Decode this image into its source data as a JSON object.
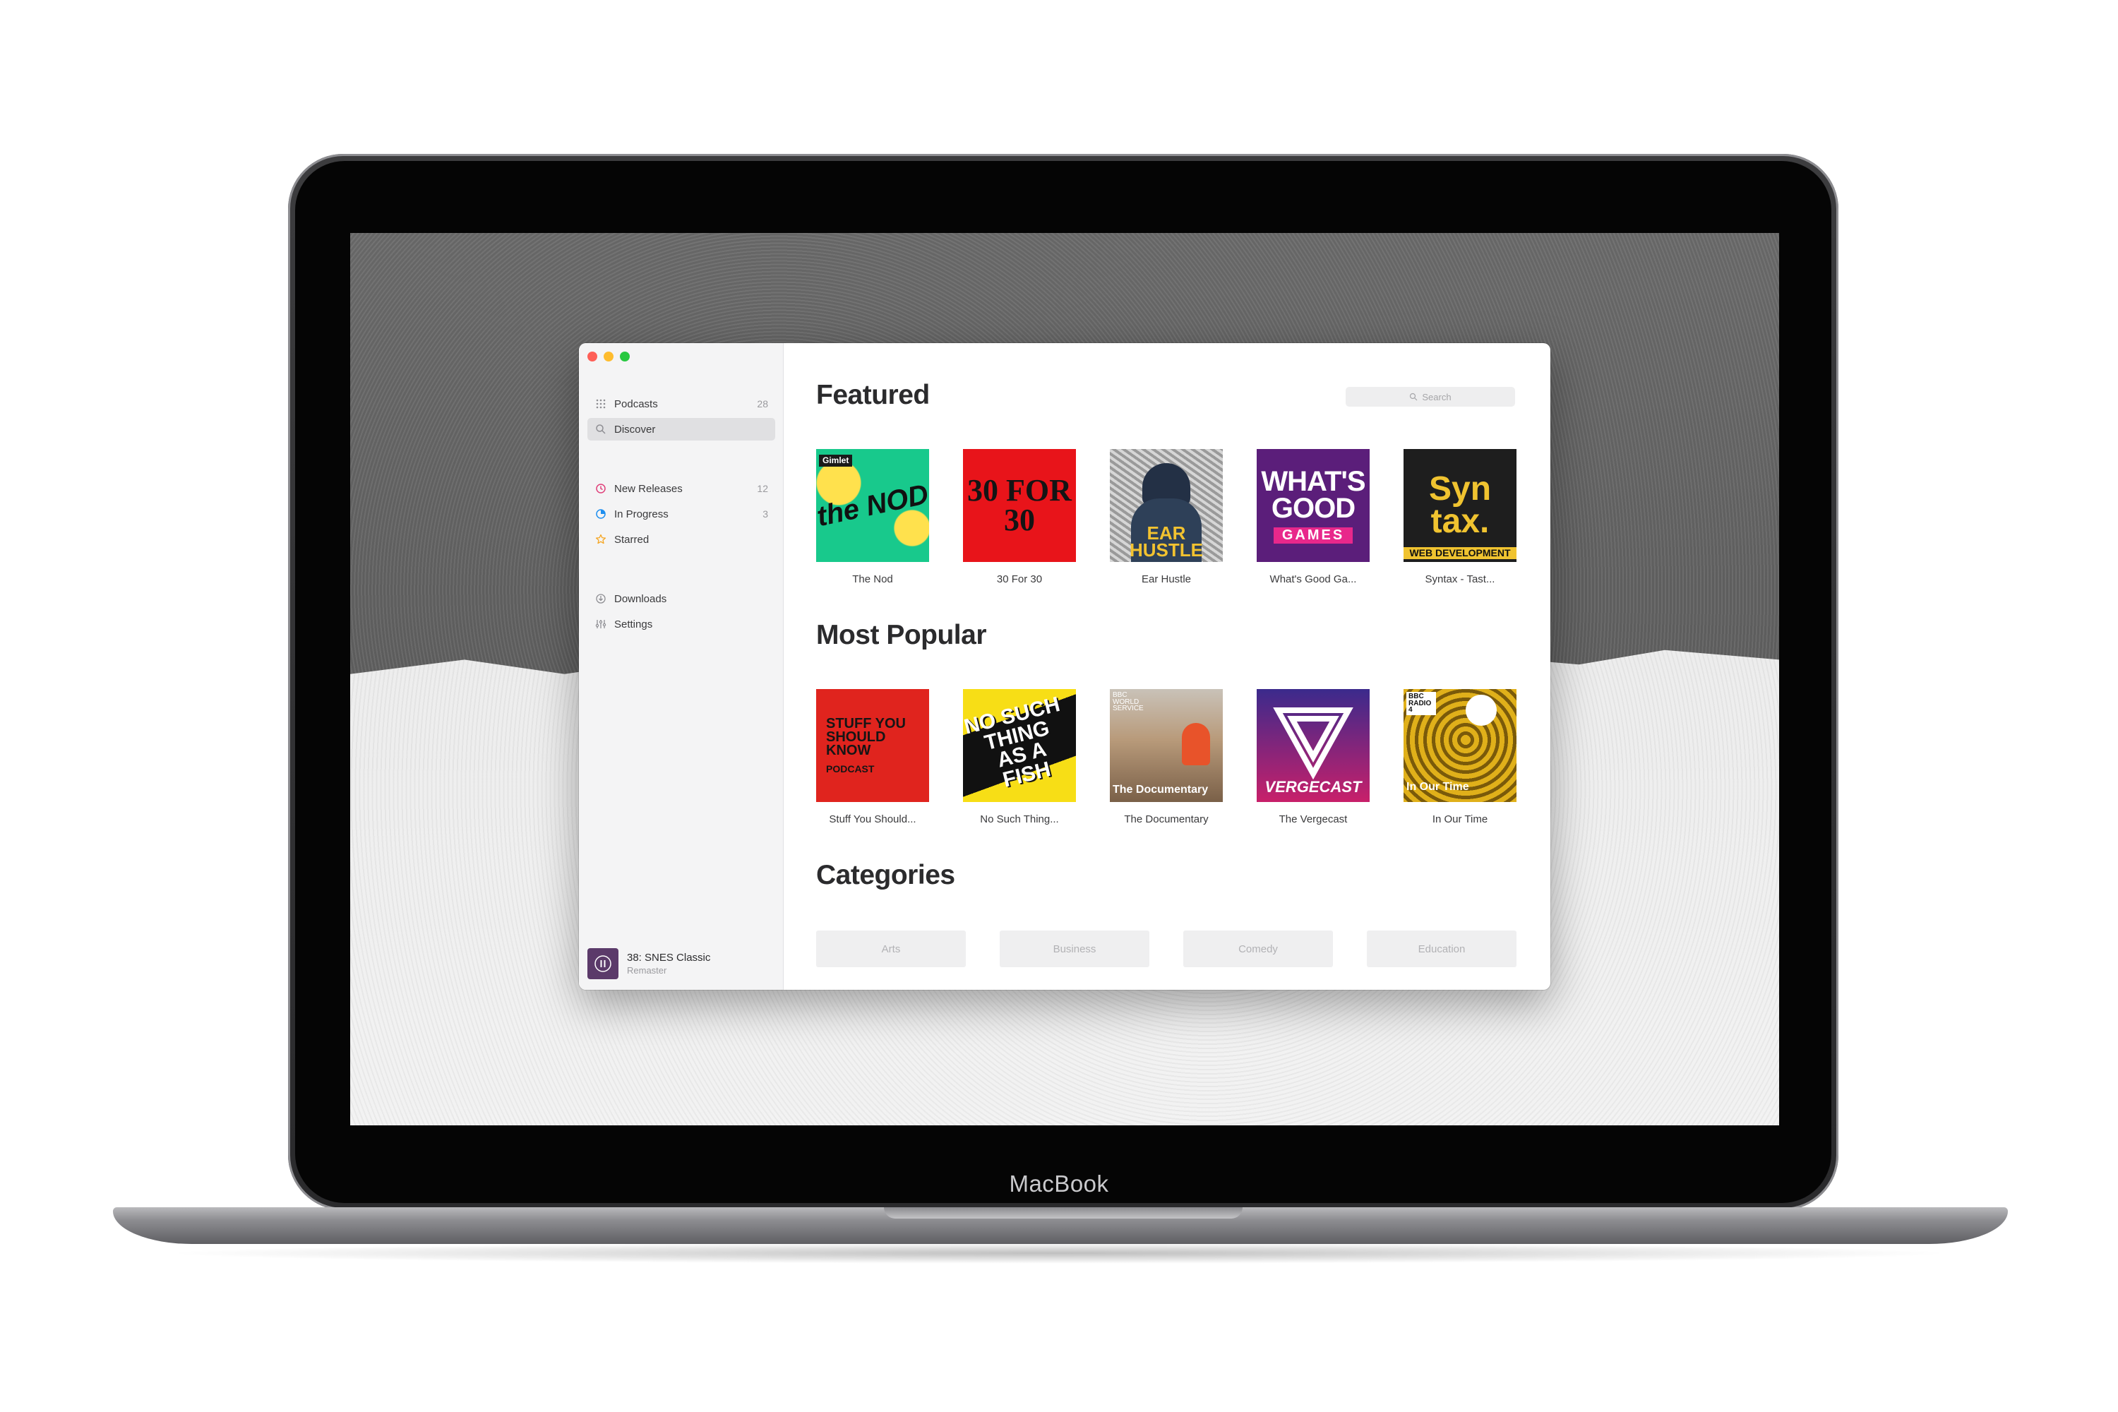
{
  "device": {
    "brand_label": "MacBook"
  },
  "sidebar": {
    "items": [
      {
        "label": "Podcasts",
        "count": "28",
        "icon": "grid-icon"
      },
      {
        "label": "Discover",
        "count": "",
        "icon": "search-icon"
      },
      {
        "label": "New Releases",
        "count": "12",
        "icon": "clock-icon",
        "color": "#e0407a"
      },
      {
        "label": "In Progress",
        "count": "3",
        "icon": "progress-icon",
        "color": "#1e8ff0"
      },
      {
        "label": "Starred",
        "count": "",
        "icon": "star-icon",
        "color": "#f5a623"
      },
      {
        "label": "Downloads",
        "count": "",
        "icon": "download-icon"
      },
      {
        "label": "Settings",
        "count": "",
        "icon": "settings-icon"
      }
    ],
    "now_playing": {
      "title": "38: SNES Classic",
      "subtitle": "Remaster"
    }
  },
  "main": {
    "search_placeholder": "Search",
    "sections": {
      "featured": "Featured",
      "most_popular": "Most Popular",
      "categories": "Categories"
    },
    "featured": [
      {
        "title": "The Nod",
        "art_text": "the NOD",
        "badge": "Gimlet"
      },
      {
        "title": "30 For 30",
        "art_text": "30 FOR 30"
      },
      {
        "title": "Ear Hustle",
        "art_text": "EAR HUSTLE"
      },
      {
        "title": "What's Good Ga...",
        "art_text": "WHAT'S GOOD",
        "art_sub": "GAMES"
      },
      {
        "title": "Syntax - Tast...",
        "art_text": "Syn tax.",
        "art_sub": "WEB DEVELOPMENT"
      }
    ],
    "most_popular": [
      {
        "title": "Stuff You Should...",
        "art_text": "STUFF YOU SHOULD KNOW",
        "art_sub": "PODCAST"
      },
      {
        "title": "No Such Thing...",
        "art_text": "NO SUCH THING AS A FISH"
      },
      {
        "title": "The Documentary",
        "art_text": "The Documentary",
        "badge": "BBC WORLD SERVICE"
      },
      {
        "title": "The Vergecast",
        "art_text": "VERGECAST"
      },
      {
        "title": "In Our Time",
        "art_text": "In Our Time",
        "badge": "BBC RADIO 4"
      }
    ],
    "categories": [
      "Arts",
      "Business",
      "Comedy",
      "Education"
    ]
  }
}
